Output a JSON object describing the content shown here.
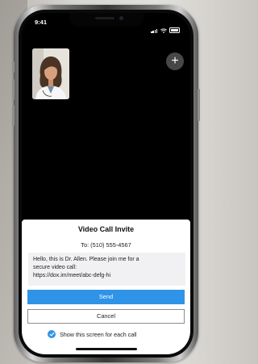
{
  "status_bar": {
    "time": "9:41"
  },
  "call_screen": {
    "add_icon": "plus-icon",
    "caller_thumbnail": "doctor-avatar"
  },
  "invite_sheet": {
    "title": "Video Call Invite",
    "recipient": "To: (510) 555-4567",
    "message": "Hello, this is Dr. Allen. Please join me for a\nsecure video call:\nhttps://dox.im/meet/abc-defg-hi",
    "send_label": "Send",
    "cancel_label": "Cancel",
    "show_screen_label": "Show this screen for each call",
    "show_screen_checked": true
  },
  "colors": {
    "accent": "#2f93e8",
    "screen_background": "#000000",
    "sheet_background": "#ffffff"
  }
}
